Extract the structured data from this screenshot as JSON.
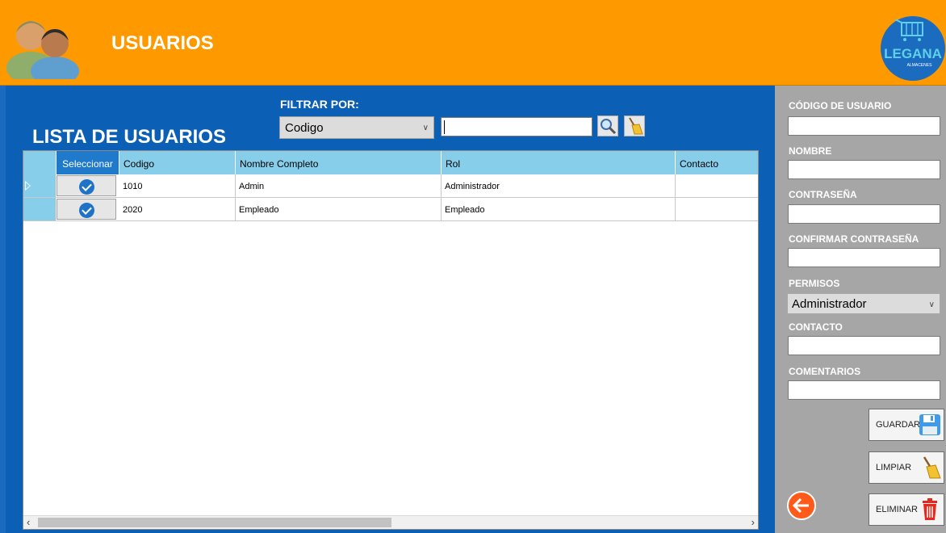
{
  "header": {
    "title": "USUARIOS",
    "logo_text": "LEGANA",
    "logo_sub": "ALMACENES"
  },
  "list": {
    "title": "LISTA DE USUARIOS"
  },
  "filter": {
    "label": "FILTRAR POR:",
    "selected": "Codigo",
    "search_value": ""
  },
  "grid": {
    "columns": [
      "Seleccionar",
      "Codigo",
      "Nombre Completo",
      "Rol",
      "Contacto"
    ],
    "rows": [
      {
        "codigo": "1010",
        "nombre": "Admin",
        "rol": "Administrador",
        "contacto": ""
      },
      {
        "codigo": "2020",
        "nombre": "Empleado",
        "rol": "Empleado",
        "contacto": ""
      }
    ]
  },
  "form": {
    "codigo_label": "CÓDIGO DE USUARIO",
    "nombre_label": "NOMBRE",
    "contrasena_label": "CONTRASEÑA",
    "confirmar_label": "CONFIRMAR CONTRASEÑA",
    "permisos_label": "PERMISOS",
    "permisos_selected": "Administrador",
    "contacto_label": "CONTACTO",
    "comentarios_label": "COMENTARIOS"
  },
  "buttons": {
    "guardar": "GUARDAR",
    "limpiar": "LIMPIAR",
    "eliminar": "ELIMINAR"
  },
  "colors": {
    "header": "#ff9900",
    "main": "#0b5fb5",
    "side": "#a6a6a6",
    "grid_header": "#87ceeb"
  }
}
